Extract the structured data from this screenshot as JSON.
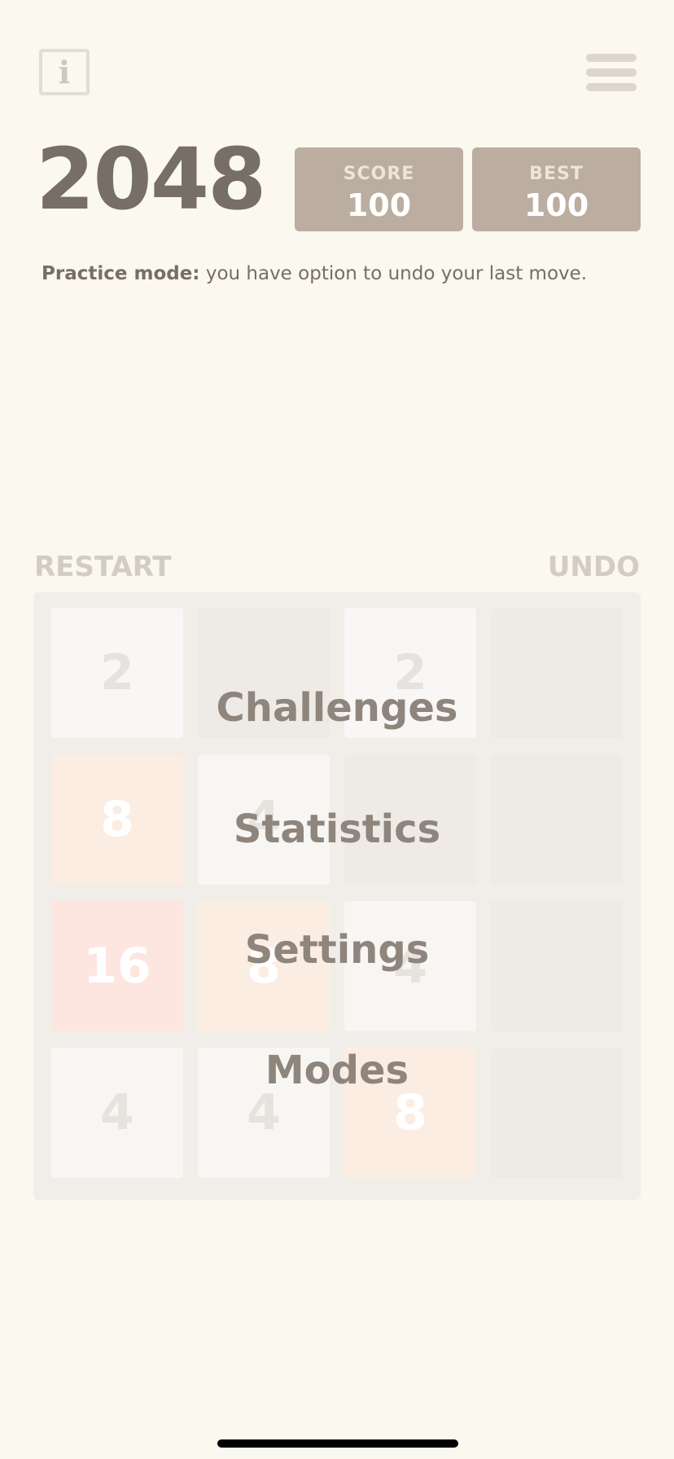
{
  "header": {
    "info_icon_glyph": "i",
    "info_icon": "info-icon",
    "menu_icon": "hamburger-menu-icon"
  },
  "game": {
    "title": "2048",
    "score_label": "SCORE",
    "score_value": "100",
    "best_label": "BEST",
    "best_value": "100"
  },
  "practice": {
    "bold_text": "Practice mode:",
    "text": " you have option to undo your last move."
  },
  "controls": {
    "restart_label": "RESTART",
    "undo_label": "UNDO"
  },
  "board": {
    "tiles": [
      [
        "2",
        "",
        "2",
        ""
      ],
      [
        "8",
        "4",
        "",
        ""
      ],
      [
        "16",
        "8",
        "4",
        ""
      ],
      [
        "4",
        "4",
        "8",
        ""
      ]
    ]
  },
  "menu": {
    "items": [
      "Challenges",
      "Statistics",
      "Settings",
      "Modes"
    ]
  },
  "colors": {
    "background": "#faf8ef",
    "board": "#f1eee9",
    "empty_cell": "#eeebe6",
    "tile_2": "#f8f7f5",
    "tile_4": "#f8f6f2",
    "tile_8": "#fcede3",
    "tile_16": "#fde6df",
    "score_box": "#bbada0",
    "text_dark": "#776e65",
    "menu_text": "#8e857c"
  }
}
